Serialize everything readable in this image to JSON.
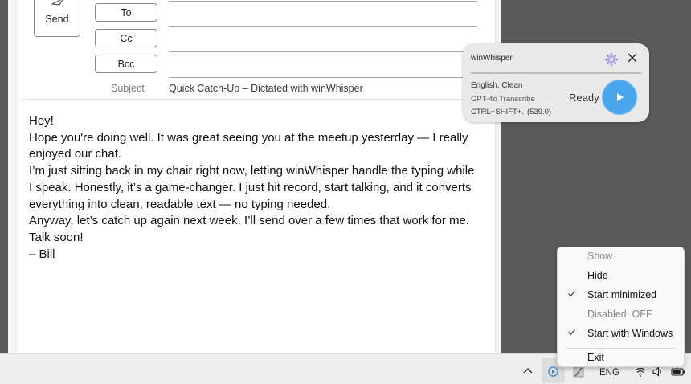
{
  "compose": {
    "send_label": "Send",
    "to_label": "To",
    "cc_label": "Cc",
    "bcc_label": "Bcc",
    "subject_label": "Subject",
    "subject_value": "Quick Catch-Up – Dictated with winWhisper",
    "body_lines": [
      "Hey!",
      "Hope you're doing well. It was great seeing you at the meetup yesterday — I really enjoyed our chat.",
      "I’m just sitting back in my chair right now, letting winWhisper handle the typing while I speak. Honestly, it’s a game-changer. I just hit record, start talking, and it converts everything into clean, readable text — no typing needed.",
      "Anyway, let’s catch up again next week. I’ll send over a few times that work for me.",
      "Talk soon!",
      "– Bill"
    ]
  },
  "widget": {
    "title": "winWhisper",
    "language_mode": "English, Clean",
    "model": "GPT-4o Transcribe",
    "hotkey": "CTRL+SHIFT+.",
    "hotkey_value": "(539.0)",
    "status": "Ready",
    "accent": "#4aa6ea",
    "icons": [
      "gear-icon",
      "close-icon",
      "play-icon"
    ]
  },
  "context_menu": {
    "items": [
      {
        "label": "Show",
        "enabled": false,
        "checked": false
      },
      {
        "label": "Hide",
        "enabled": true,
        "checked": false
      },
      {
        "label": "Start minimized",
        "enabled": true,
        "checked": true
      },
      {
        "label": "Disabled: OFF",
        "enabled": false,
        "checked": false
      },
      {
        "label": "Start with Windows",
        "enabled": true,
        "checked": true
      },
      {
        "label": "Exit",
        "enabled": true,
        "checked": false
      }
    ]
  },
  "taskbar": {
    "language": "ENG",
    "icons": [
      "chevron-up-icon",
      "winwhisper-tray-icon",
      "pen-icon",
      "wifi-icon",
      "volume-icon",
      "battery-icon"
    ]
  }
}
